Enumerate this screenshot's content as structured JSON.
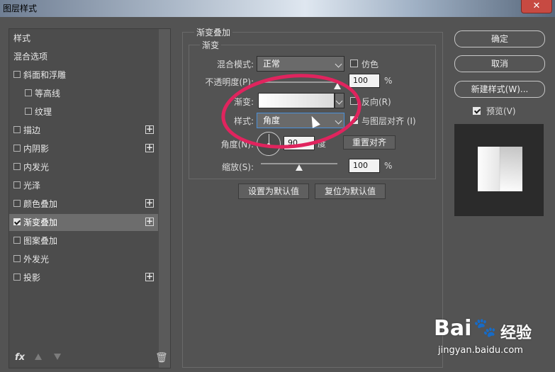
{
  "window": {
    "title": "图层样式",
    "close_label": "✕"
  },
  "left_panel": {
    "items": [
      {
        "label": "样式",
        "checkbox": false,
        "checked": false,
        "plus": false,
        "selected": false
      },
      {
        "label": "混合选项",
        "checkbox": false,
        "checked": false,
        "plus": false,
        "selected": false
      },
      {
        "label": "斜面和浮雕",
        "checkbox": true,
        "checked": false,
        "plus": false,
        "selected": false
      },
      {
        "label": "等高线",
        "checkbox": true,
        "checked": false,
        "plus": false,
        "selected": false
      },
      {
        "label": "纹理",
        "checkbox": true,
        "checked": false,
        "plus": false,
        "selected": false
      },
      {
        "label": "描边",
        "checkbox": true,
        "checked": false,
        "plus": true,
        "selected": false
      },
      {
        "label": "内阴影",
        "checkbox": true,
        "checked": false,
        "plus": true,
        "selected": false
      },
      {
        "label": "内发光",
        "checkbox": true,
        "checked": false,
        "plus": false,
        "selected": false
      },
      {
        "label": "光泽",
        "checkbox": true,
        "checked": false,
        "plus": false,
        "selected": false
      },
      {
        "label": "颜色叠加",
        "checkbox": true,
        "checked": false,
        "plus": true,
        "selected": false
      },
      {
        "label": "渐变叠加",
        "checkbox": true,
        "checked": true,
        "plus": true,
        "selected": true
      },
      {
        "label": "图案叠加",
        "checkbox": true,
        "checked": false,
        "plus": false,
        "selected": false
      },
      {
        "label": "外发光",
        "checkbox": true,
        "checked": false,
        "plus": false,
        "selected": false
      },
      {
        "label": "投影",
        "checkbox": true,
        "checked": false,
        "plus": true,
        "selected": false
      }
    ],
    "plus_label": "+",
    "footer": {
      "fx_label": "fx",
      "trash_icon": "🗑"
    }
  },
  "gradient_overlay": {
    "group_title": "渐变叠加",
    "sub_title": "渐变",
    "blend_mode_label": "混合模式:",
    "blend_mode_value": "正常",
    "dither_label": "仿色",
    "dither_checked": false,
    "opacity_label": "不透明度(P):",
    "opacity_value": "100",
    "opacity_unit": "%",
    "opacity_level": 1.0,
    "gradient_label": "渐变:",
    "reverse_label": "反向(R)",
    "reverse_checked": false,
    "style_label": "样式:",
    "style_value": "角度",
    "align_label": "与图层对齐 (I)",
    "align_checked": true,
    "angle_label": "角度(N):",
    "angle_value": "90",
    "angle_unit": "度",
    "reset_align_label": "重置对齐",
    "scale_label": "缩放(S):",
    "scale_value": "100",
    "scale_unit": "%",
    "scale_level": 0.5,
    "set_default_label": "设置为默认值",
    "reset_default_label": "复位为默认值"
  },
  "right_panel": {
    "ok_label": "确定",
    "cancel_label": "取消",
    "new_style_label": "新建样式(W)...",
    "preview_label": "预览(V)",
    "preview_checked": true
  },
  "watermark": {
    "brand_left": "Bai",
    "brand_right": "经验",
    "url": "jingyan.baidu.com"
  },
  "colors": {
    "highlight": "#e0245e",
    "panel_bg": "#535353"
  }
}
